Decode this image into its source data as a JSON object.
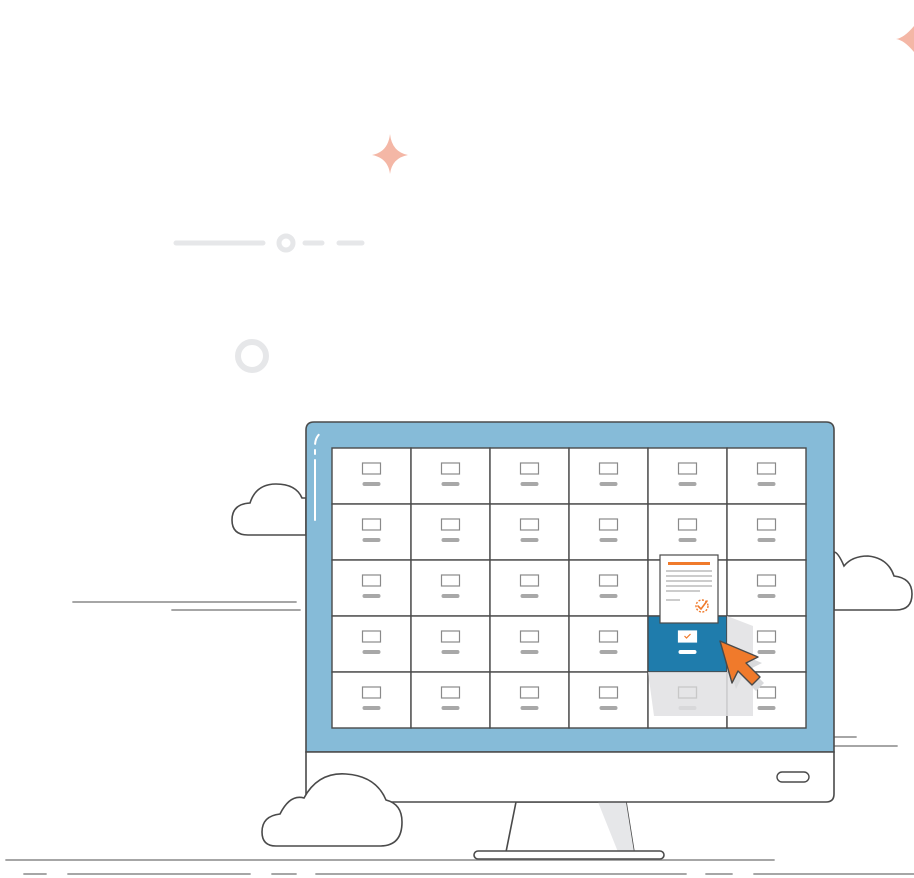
{
  "scene": {
    "grid": {
      "rows": 5,
      "cols": 6
    },
    "selected_cell": {
      "row": 4,
      "col": 5
    },
    "document_cell": {
      "row": 3,
      "col": 5
    },
    "icons": [
      "sparkle-icon",
      "cloud-icon",
      "drawer-icon",
      "document-icon",
      "checkmark-badge-icon",
      "cursor-arrow-icon",
      "power-button-icon"
    ]
  },
  "colors": {
    "monitor_frame": "#86BBD8",
    "monitor_outline": "#4A4A4A",
    "cell_fill": "#FFFFFF",
    "selected_cell": "#1F7CAC",
    "accent_orange": "#F07A2B",
    "sparkle": "#F4B7A6",
    "line_gray": "#9A9A9A",
    "shadow": "#E6E7E9"
  }
}
